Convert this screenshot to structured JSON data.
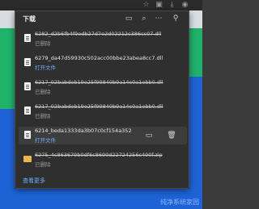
{
  "panel": {
    "title": "下载",
    "see_more": "查看更多"
  },
  "items": [
    {
      "name": "6282_d2b6fb4f9edb27d7e2d02212c386cc07.dll",
      "status": "已删除",
      "deleted": true
    },
    {
      "name": "6279_da47d59930c502acc00bbe23abea8cc7.dll",
      "status": "打开文件",
      "deleted": false
    },
    {
      "name": "6217_02babdeb19e25f99840b9a14c0a1ebb0.dll",
      "status": "已删除",
      "deleted": true
    },
    {
      "name": "6217_02babdeb19e25f99840b9a14c0a1ebb0.dll",
      "status": "已删除",
      "deleted": true
    },
    {
      "name": "6214_beda1333da3b07c0cf154a352",
      "status": "打开文件",
      "deleted": false
    },
    {
      "name": "6275_4c863679b0df6c8690d22724256c490f.zip",
      "status": "已删除",
      "deleted": true
    }
  ],
  "watermark": "纯净系统家园"
}
